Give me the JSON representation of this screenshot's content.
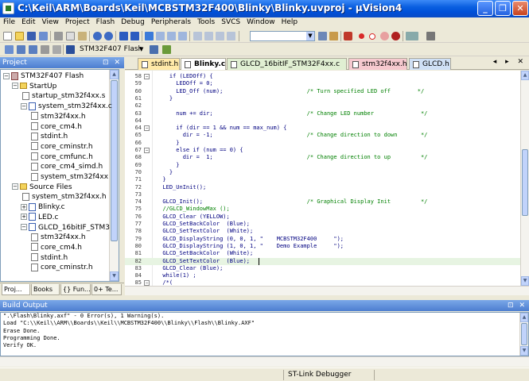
{
  "window": {
    "title": "C:\\Keil\\ARM\\Boards\\Keil\\MCBSTM32F400\\Blinky\\Blinky.uvproj - µVision4",
    "minimize": "_",
    "maximize": "❐",
    "close": "✕"
  },
  "menu": [
    "File",
    "Edit",
    "View",
    "Project",
    "Flash",
    "Debug",
    "Peripherals",
    "Tools",
    "SVCS",
    "Window",
    "Help"
  ],
  "toolbar": {
    "target": "STM32F407 Flash"
  },
  "project_panel": {
    "title": "Project",
    "controls": "⊡ ✕",
    "tree": [
      {
        "label": "STM32F407 Flash",
        "indent": 0,
        "type": "project",
        "expander": "−"
      },
      {
        "label": "StartUp",
        "indent": 1,
        "type": "folder",
        "expander": "−"
      },
      {
        "label": "startup_stm32f4xx.s",
        "indent": 2,
        "type": "file"
      },
      {
        "label": "system_stm32f4xx.c",
        "indent": 2,
        "type": "cfile",
        "expander": "−"
      },
      {
        "label": "stm32f4xx.h",
        "indent": 3,
        "type": "file"
      },
      {
        "label": "core_cm4.h",
        "indent": 3,
        "type": "file"
      },
      {
        "label": "stdint.h",
        "indent": 3,
        "type": "file"
      },
      {
        "label": "core_cminstr.h",
        "indent": 3,
        "type": "file"
      },
      {
        "label": "core_cmfunc.h",
        "indent": 3,
        "type": "file"
      },
      {
        "label": "core_cm4_simd.h",
        "indent": 3,
        "type": "file"
      },
      {
        "label": "system_stm32f4xx",
        "indent": 3,
        "type": "file"
      },
      {
        "label": "Source Files",
        "indent": 1,
        "type": "folder",
        "expander": "−"
      },
      {
        "label": "system_stm32f4xx.h",
        "indent": 2,
        "type": "file"
      },
      {
        "label": "Blinky.c",
        "indent": 2,
        "type": "cfile",
        "expander": "+"
      },
      {
        "label": "LED.c",
        "indent": 2,
        "type": "cfile",
        "expander": "+"
      },
      {
        "label": "GLCD_16bitIF_STM3",
        "indent": 2,
        "type": "cfile",
        "expander": "−"
      },
      {
        "label": "stm32f4xx.h",
        "indent": 3,
        "type": "file"
      },
      {
        "label": "core_cm4.h",
        "indent": 3,
        "type": "file"
      },
      {
        "label": "stdint.h",
        "indent": 3,
        "type": "file"
      },
      {
        "label": "core_cminstr.h",
        "indent": 3,
        "type": "file"
      }
    ],
    "tabs": [
      "Proj...",
      "Books",
      "{} Fun...",
      "0+ Te..."
    ]
  },
  "editor": {
    "tabs": [
      "stdint.h",
      "Blinky.c",
      "GLCD_16bitIF_STM32F4xx.c",
      "stm32f4xx.h",
      "GLCD.h"
    ],
    "active_tab": "Blinky.c",
    "tab_controls": "◂ ▸ ✕",
    "lines": [
      {
        "n": "58",
        "fold": "−",
        "text": "    if (LEDOff) {"
      },
      {
        "n": "59",
        "text": "      LEDOff = 0;"
      },
      {
        "n": "60",
        "text": "      LED_Off (num);",
        "comment": "/* Turn specified LED off        */",
        "cpad": 25
      },
      {
        "n": "61",
        "text": "    }"
      },
      {
        "n": "62",
        "text": ""
      },
      {
        "n": "63",
        "text": "      num += dir;",
        "comment": "/* Change LED number              */",
        "cpad": 25
      },
      {
        "n": "64",
        "text": ""
      },
      {
        "n": "64",
        "fold": "−",
        "text": "      if (dir == 1 && num == max_num) {"
      },
      {
        "n": "65",
        "text": "        dir = -1;",
        "comment": "/* Change direction to down       */",
        "cpad": 25
      },
      {
        "n": "66",
        "text": "      }"
      },
      {
        "n": "67",
        "fold": "−",
        "text": "      else if (num == 0) {"
      },
      {
        "n": "68",
        "text": "        dir =  1;",
        "comment": "/* Change direction to up         */",
        "cpad": 25
      },
      {
        "n": "69",
        "text": "      }"
      },
      {
        "n": "70",
        "text": "    }"
      },
      {
        "n": "71",
        "text": "  }"
      },
      {
        "n": "72",
        "text": "  LED_UnInit();"
      },
      {
        "n": "73",
        "text": ""
      },
      {
        "n": "74",
        "text": "  GLCD_Init();",
        "comment": "/* Graphical Display Init         */",
        "cpad": 22
      },
      {
        "n": "75",
        "text": "  ",
        "comment": "//GLCD_WindowMax ();",
        "cpad": 0
      },
      {
        "n": "76",
        "text": "  GLCD_Clear (YELLOW);"
      },
      {
        "n": "77",
        "text": "  GLCD_SetBackColor  (Blue);"
      },
      {
        "n": "78",
        "text": "  GLCD_SetTextColor  (White);"
      },
      {
        "n": "79",
        "text": "  GLCD_DisplayString (0, 0, 1, \"    MCBSTM32F400     \");"
      },
      {
        "n": "80",
        "text": "  GLCD_DisplayString (1, 0, 1, \"    Demo Example     \");"
      },
      {
        "n": "81",
        "text": "  GLCD_SetBackColor  (White);"
      },
      {
        "n": "82",
        "text": "  GLCD_SetTextColor  (Blue);",
        "highlight": true
      },
      {
        "n": "83",
        "text": "  GLCD_Clear (Blue);"
      },
      {
        "n": "84",
        "text": "  while(1) ;"
      },
      {
        "n": "85",
        "fold": "−",
        "text": "  /*("
      }
    ]
  },
  "build_output": {
    "title": "Build Output",
    "controls": "⊡ ✕",
    "lines": [
      "\".\\Flash\\Blinky.axf\" - 0 Error(s), 1 Warning(s).",
      "Load \"C:\\\\Keil\\\\ARM\\\\Boards\\\\Keil\\\\MCBSTM32F400\\\\Blinky\\\\Flash\\\\Blinky.AXF\"",
      "Erase Done.",
      "Programming Done.",
      "Verify OK."
    ]
  },
  "status": {
    "debugger": "ST-Link Debugger"
  }
}
